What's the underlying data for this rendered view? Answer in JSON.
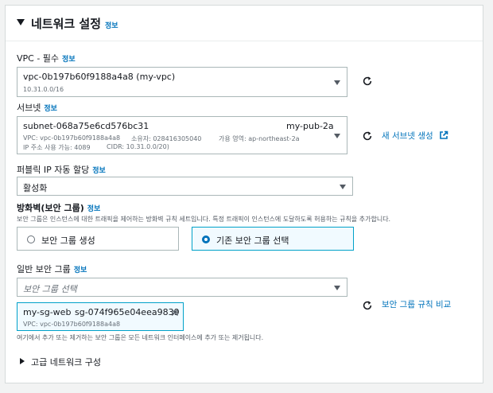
{
  "section": {
    "title": "네트워크 설정",
    "info": "정보"
  },
  "vpc": {
    "label": "VPC - 필수",
    "info": "정보",
    "value": "vpc-0b197b60f9188a4a8 (my-vpc)",
    "cidr": "10.31.0.0/16"
  },
  "subnet": {
    "label": "서브넷",
    "info": "정보",
    "id": "subnet-068a75e6cd576bc31",
    "name": "my-pub-2a",
    "vpc_text": "VPC: vpc-0b197b60f9188a4a8",
    "owner_text": "소유자: 028416305040",
    "az_text": "가용 영역: ap-northeast-2a",
    "ip_text": "IP 주소 사용 가능: 4089",
    "cidr_text": "CIDR: 10.31.0.0/20)",
    "create_link": "새 서브넷 생성"
  },
  "public_ip": {
    "label": "퍼블릭 IP 자동 할당",
    "info": "정보",
    "value": "활성화"
  },
  "firewall": {
    "label": "방화벽(보안 그룹)",
    "info": "정보",
    "description": "보안 그룹은 인스턴스에 대한 트래픽을 제어하는 방화벽 규칙 세트입니다. 특정 트래픽이 인스턴스에 도달하도록 허용하는 규칙을 추가합니다.",
    "option_create": "보안 그룹 생성",
    "option_existing": "기존 보안 그룹 선택",
    "selected": "option_existing"
  },
  "common_sg": {
    "label": "일반 보안 그룹",
    "info": "정보",
    "placeholder": "보안 그룹 선택",
    "token_name": "my-sg-web",
    "token_id": "sg-074f965e04eea9839",
    "token_vpc": "VPC: vpc-0b197b60f9188a4a8",
    "compare_link": "보안 그룹 규칙 비교",
    "note": "여기에서 추가 또는 제거하는 보안 그룹은 모든 네트워크 인터페이스에 추가 또는 제거됩니다."
  },
  "advanced": {
    "label": "고급 네트워크 구성"
  },
  "colors": {
    "link": "#0073bb",
    "border": "#aab7b8",
    "selected_border": "#00a1c9",
    "selected_bg": "#f1faff"
  }
}
